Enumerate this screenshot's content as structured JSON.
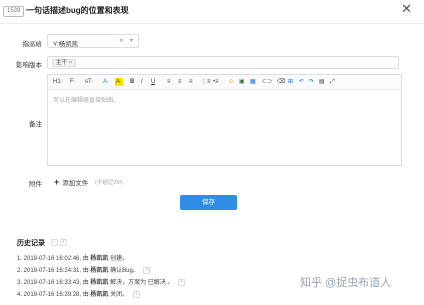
{
  "header": {
    "bug_id": "1539",
    "title": "一句话描述bug的位置和表现"
  },
  "form": {
    "assignee_label": "指派给",
    "assignee_value": "Y:杨凯凯",
    "version_label": "影响版本",
    "version_tag": "主干",
    "notes_label": "备注",
    "editor_placeholder": "可以在编辑器直接贴图。",
    "attachment_label": "附件",
    "attach_button": "添加文件",
    "attach_note": "(不超过2M)",
    "save_button": "保存"
  },
  "toolbar": {
    "heading": "H1·",
    "font": "F·",
    "size": "sT·",
    "font_color": "A·",
    "bg_color": "A·",
    "bold": "B",
    "italic": "I",
    "underline": "U"
  },
  "history": {
    "title": "历史记录",
    "items": [
      {
        "date": "1. 2019-07-16 16:02:46,",
        "by": "由",
        "user": "杨凯凯",
        "action": "创建。",
        "has_expand": false
      },
      {
        "date": "2. 2019-07-16 16:24:31,",
        "by": "由",
        "user": "杨凯凯",
        "action": "确认Bug。",
        "has_expand": true
      },
      {
        "date": "3. 2019-07-16 16:33:43,",
        "by": "由",
        "user": "杨凯凯",
        "action": "解决，方案为 已解决 。",
        "has_expand": true
      },
      {
        "date": "4. 2019-07-16 16:39:28,",
        "by": "由",
        "user": "杨凯凯",
        "action": "关闭。",
        "has_expand": true
      }
    ]
  },
  "watermark": "知乎 @捉虫布道人"
}
